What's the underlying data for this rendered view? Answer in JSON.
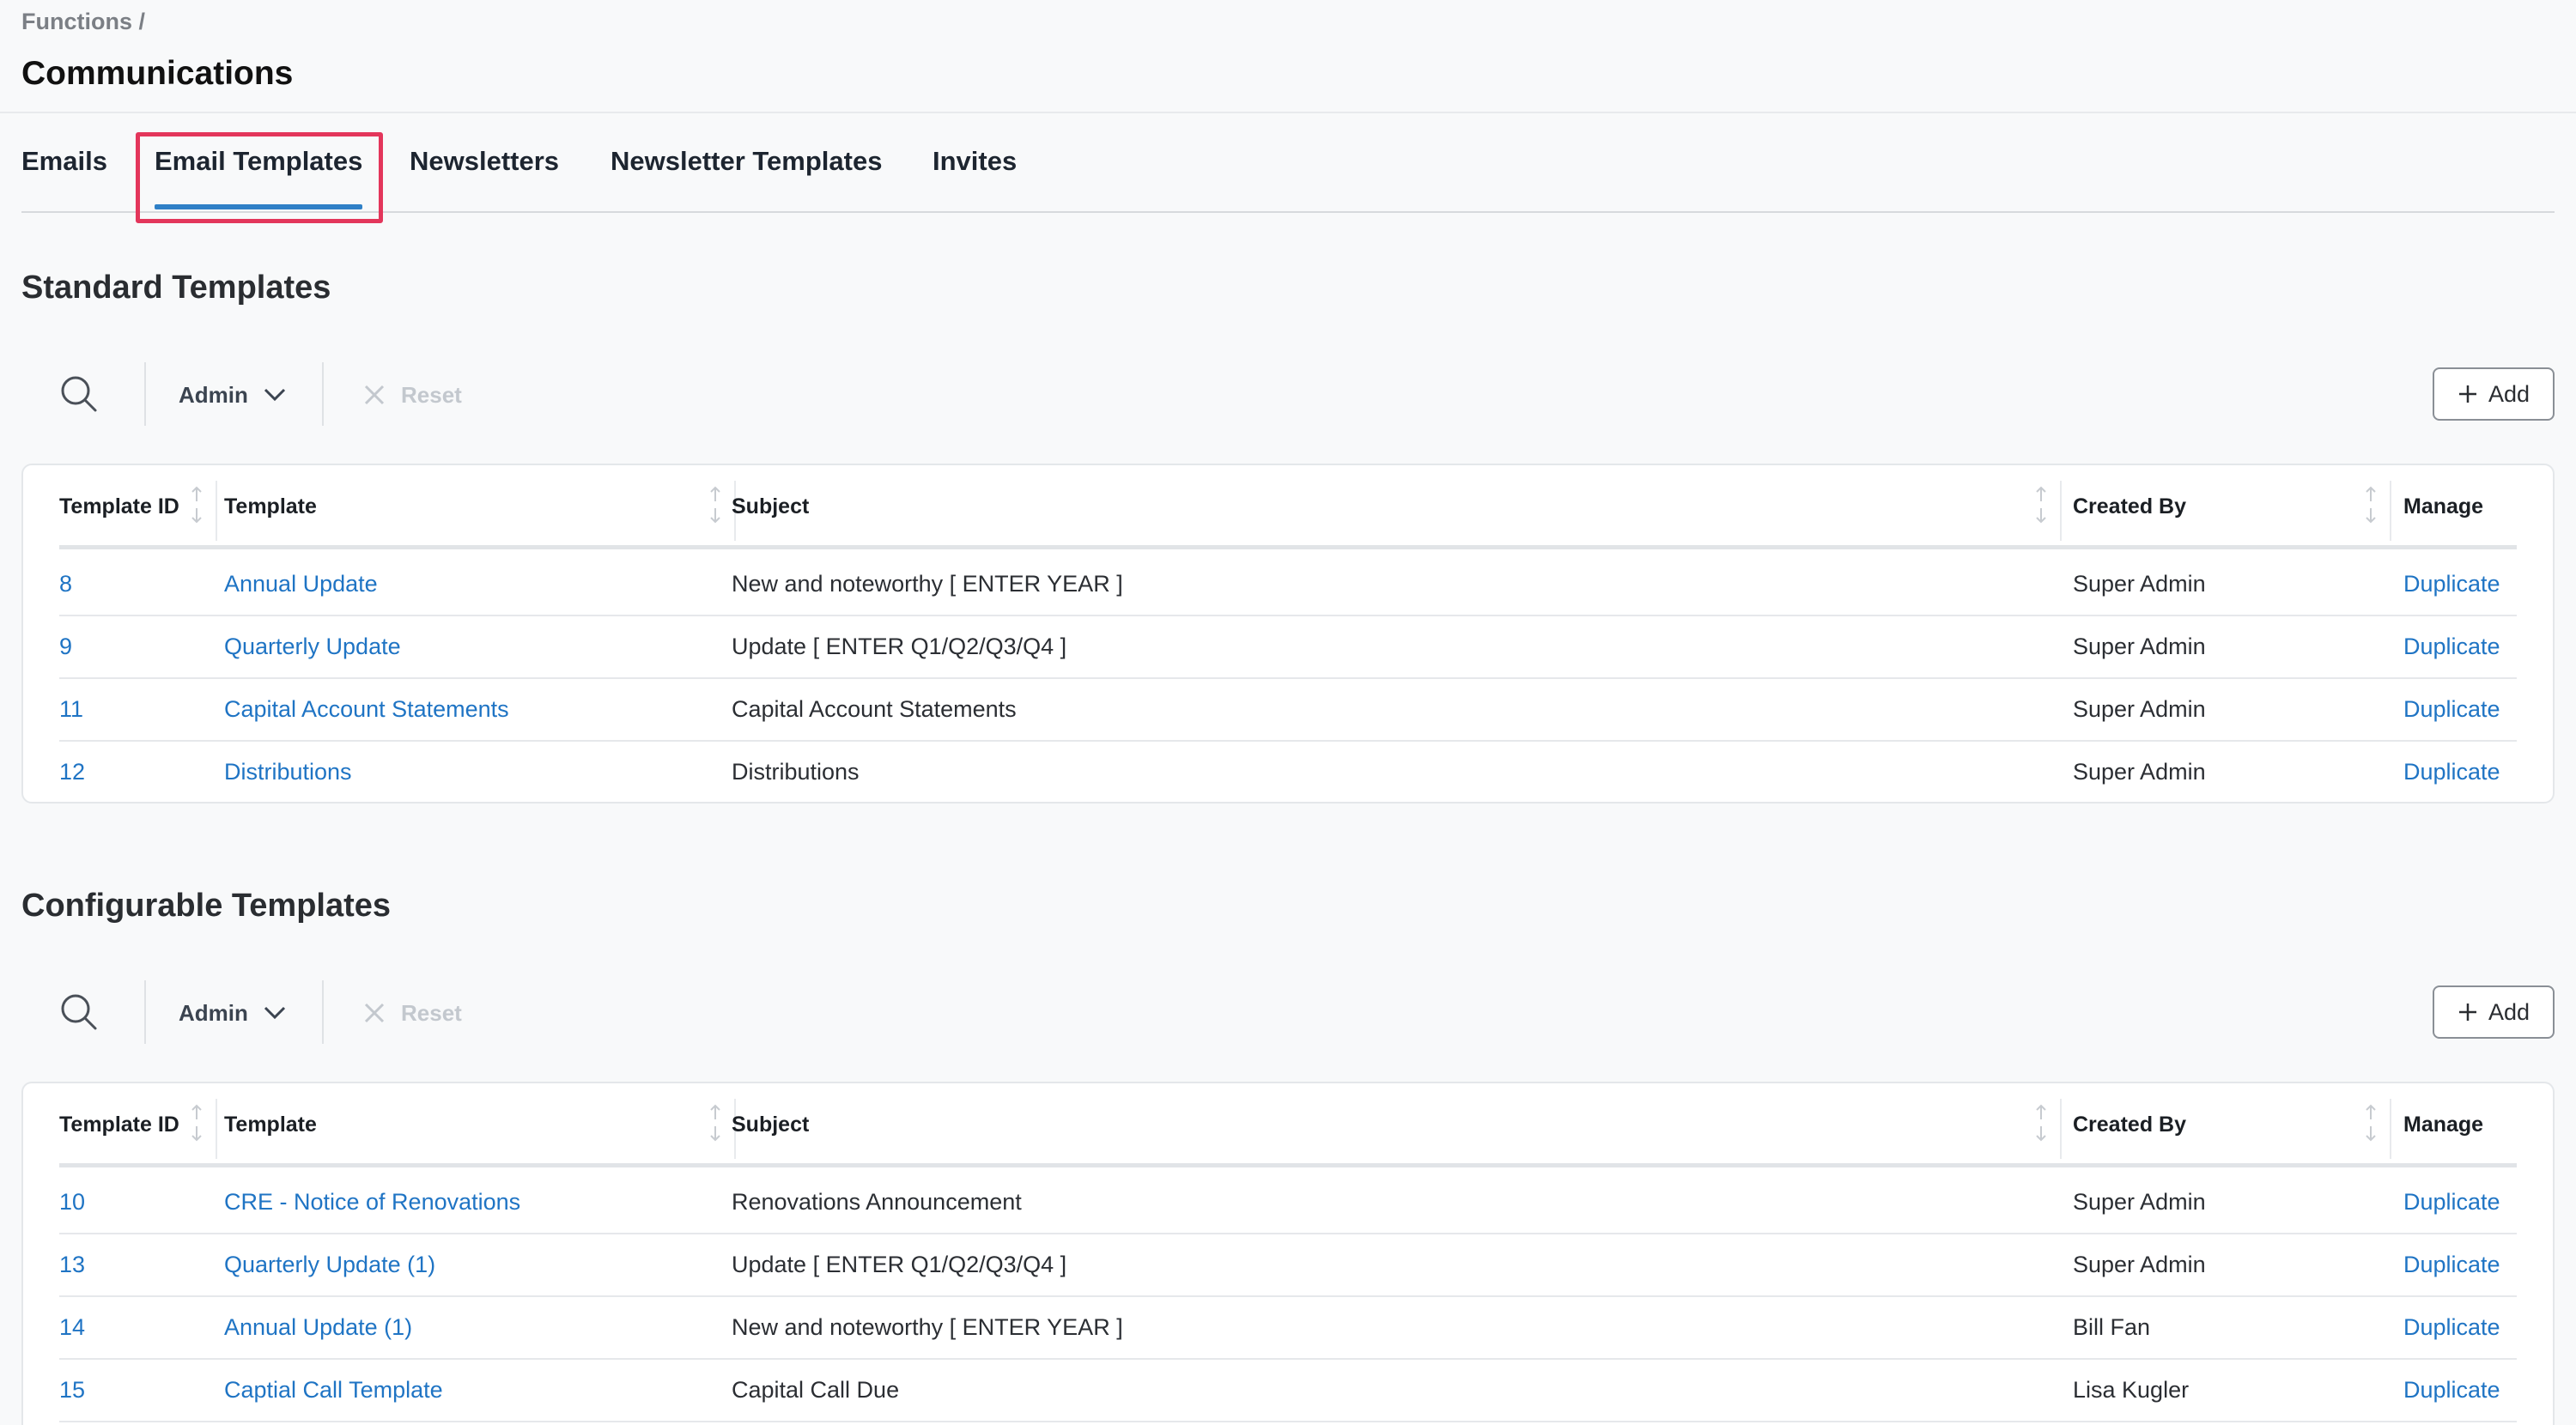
{
  "breadcrumb": "Functions /",
  "page_title": "Communications",
  "tabs": [
    {
      "label": "Emails"
    },
    {
      "label": "Email Templates",
      "active": true
    },
    {
      "label": "Newsletters"
    },
    {
      "label": "Newsletter Templates"
    },
    {
      "label": "Invites"
    }
  ],
  "colors": {
    "accent": "#2f80c7",
    "link": "#1f74c4",
    "highlight": "#e3365b"
  },
  "standard": {
    "title": "Standard Templates",
    "toolbar": {
      "search_icon": "search-icon",
      "filter_label": "Admin",
      "reset_label": "Reset",
      "add_label": "Add"
    },
    "columns": [
      "Template ID",
      "Template",
      "Subject",
      "Created By",
      "Manage"
    ],
    "rows": [
      {
        "id": "8",
        "template": "Annual Update",
        "subject": "New and noteworthy [ ENTER YEAR ]",
        "created_by": "Super Admin",
        "manage": "Duplicate"
      },
      {
        "id": "9",
        "template": "Quarterly Update",
        "subject": "Update [ ENTER Q1/Q2/Q3/Q4 ]",
        "created_by": "Super Admin",
        "manage": "Duplicate"
      },
      {
        "id": "11",
        "template": "Capital Account Statements",
        "subject": "Capital Account Statements",
        "created_by": "Super Admin",
        "manage": "Duplicate"
      },
      {
        "id": "12",
        "template": "Distributions",
        "subject": "Distributions",
        "created_by": "Super Admin",
        "manage": "Duplicate"
      }
    ]
  },
  "configurable": {
    "title": "Configurable Templates",
    "toolbar": {
      "search_icon": "search-icon",
      "filter_label": "Admin",
      "reset_label": "Reset",
      "add_label": "Add"
    },
    "columns": [
      "Template ID",
      "Template",
      "Subject",
      "Created By",
      "Manage"
    ],
    "rows": [
      {
        "id": "10",
        "template": "CRE - Notice of Renovations",
        "subject": "Renovations Announcement",
        "created_by": "Super Admin",
        "manage": "Duplicate"
      },
      {
        "id": "13",
        "template": "Quarterly Update (1)",
        "subject": "Update [ ENTER Q1/Q2/Q3/Q4 ]",
        "created_by": "Super Admin",
        "manage": "Duplicate"
      },
      {
        "id": "14",
        "template": "Annual Update (1)",
        "subject": "New and noteworthy [ ENTER YEAR ]",
        "created_by": "Bill Fan",
        "manage": "Duplicate"
      },
      {
        "id": "15",
        "template": "Captial Call Template",
        "subject": "Capital Call Due",
        "created_by": "Lisa Kugler",
        "manage": "Duplicate"
      }
    ]
  }
}
